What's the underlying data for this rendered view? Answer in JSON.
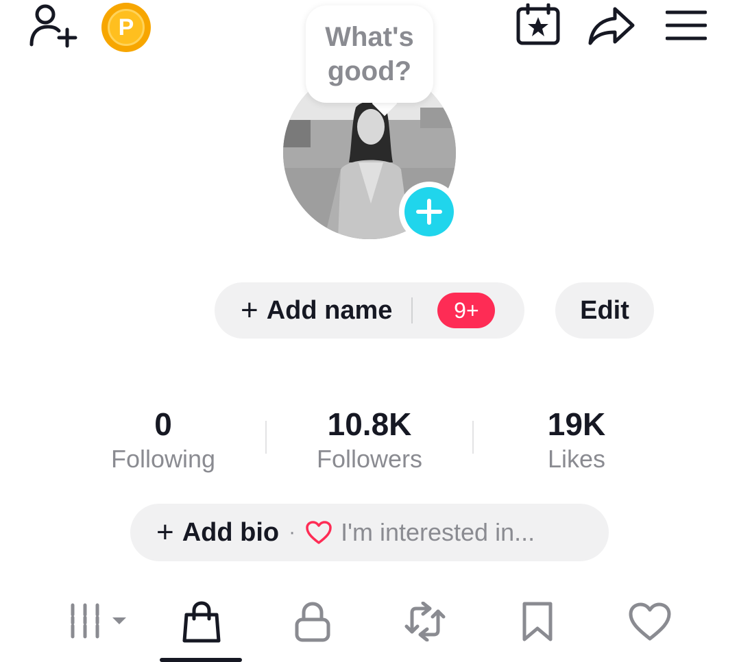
{
  "header": {
    "add_friend_icon": "person-plus-icon",
    "coin_letter": "P",
    "calendar_icon": "calendar-star-icon",
    "share_icon": "share-arrow-icon",
    "menu_icon": "hamburger-menu-icon"
  },
  "bubble": {
    "text": "What's good?"
  },
  "avatar": {
    "add_icon": "plus-icon",
    "accent": "#20d5ec"
  },
  "profile": {
    "add_name_plus": "+",
    "add_name_label": "Add name",
    "badge": "9+",
    "edit_label": "Edit"
  },
  "stats": [
    {
      "value": "0",
      "label": "Following"
    },
    {
      "value": "10.8K",
      "label": "Followers"
    },
    {
      "value": "19K",
      "label": "Likes"
    }
  ],
  "bio": {
    "plus": "+",
    "add_label": "Add bio",
    "separator": "·",
    "interest_text": "I'm interested in..."
  },
  "tabs": [
    {
      "icon": "grid-icon",
      "active": false
    },
    {
      "icon": "shopping-bag-icon",
      "active": true
    },
    {
      "icon": "lock-icon",
      "active": false
    },
    {
      "icon": "repost-icon",
      "active": false
    },
    {
      "icon": "bookmark-icon",
      "active": false
    },
    {
      "icon": "heart-icon",
      "active": false
    }
  ],
  "colors": {
    "badge": "#fe2c55",
    "accent": "#20d5ec",
    "coin": "#f7a600",
    "pill_bg": "#f1f1f2",
    "muted_text": "#8a8b91"
  }
}
